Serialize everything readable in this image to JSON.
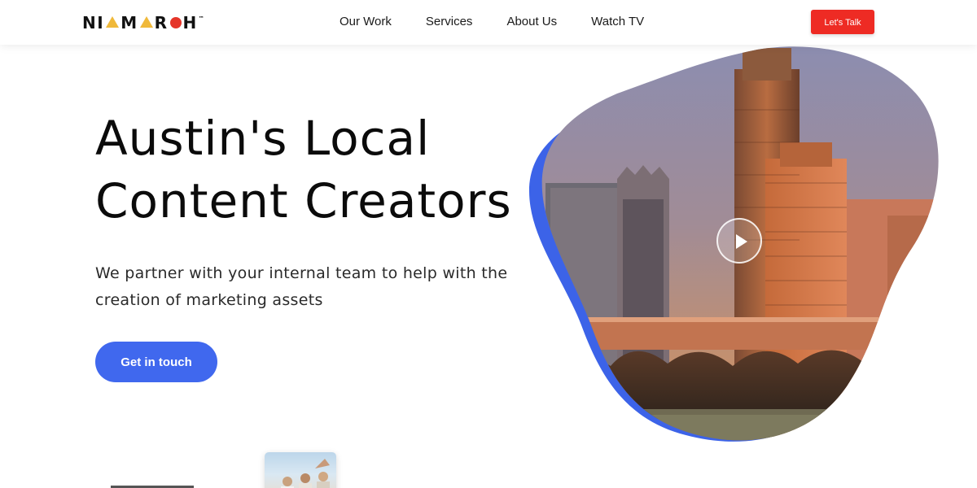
{
  "brand": {
    "name": "NIMAROH",
    "parts": [
      "NI",
      "M",
      "R",
      "H"
    ],
    "trademark": "™",
    "colors": {
      "triangle": "#f0b93a",
      "dot": "#e53529"
    }
  },
  "nav": {
    "items": [
      "Our Work",
      "Services",
      "About Us",
      "Watch TV"
    ]
  },
  "header": {
    "cta_label": "Let's Talk",
    "cta_color": "#ee2b24"
  },
  "hero": {
    "title_lines": [
      "Austin's Local",
      "Content Creators"
    ],
    "subtitle_lines": [
      "We partner with your internal team to help with the",
      "creation of marketing assets"
    ],
    "button_label": "Get in touch",
    "button_color": "#4068ee",
    "media": {
      "description_icon": "play-icon",
      "blob_accent": "#3c63e8"
    }
  }
}
